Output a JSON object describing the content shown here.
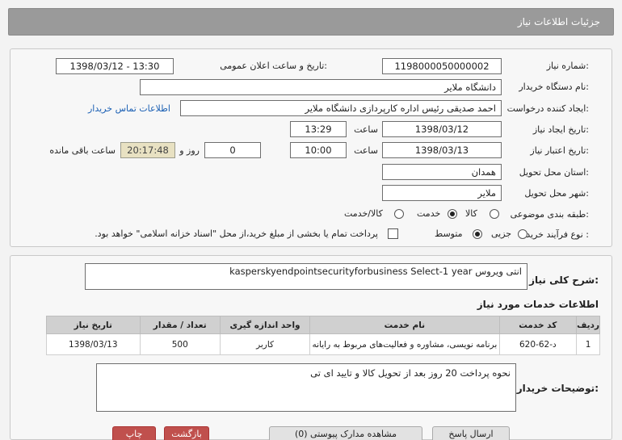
{
  "header": {
    "title": "جزئیات اطلاعات نیاز"
  },
  "form": {
    "need_number_label": "شماره نیاز:",
    "need_number": "1198000050000002",
    "announce_label": "تاریخ و ساعت اعلان عمومی:",
    "announce_value": "1398/03/12 - 13:30",
    "buyer_org_label": "نام دستگاه خریدار:",
    "buyer_org": "دانشگاه ملایر",
    "requester_label": "ایجاد کننده درخواست:",
    "requester": "احمد صدیقی رئیس اداره کارپردازی دانشگاه ملایر",
    "contact_link": "اطلاعات تماس خریدار",
    "created_date_label": "تاریخ ایجاد نیاز:",
    "created_date": "1398/03/12",
    "time_label": "ساعت",
    "created_time": "13:29",
    "validity_label": "تاریخ اعتبار نیاز:",
    "validity_date": "1398/03/13",
    "validity_time": "10:00",
    "days_value": "0",
    "days_label": "روز و",
    "remaining_time": "20:17:48",
    "remaining_label": "ساعت باقی مانده",
    "province_label": "استان محل تحویل:",
    "province": "همدان",
    "city_label": "شهر محل تحویل:",
    "city": "ملایر",
    "category_label": "طبقه بندی موضوعی:",
    "category_options": [
      "کالا",
      "خدمت",
      "کالا/خدمت"
    ],
    "process_label": "نوع فرآیند خرید :",
    "process_options": [
      "جزیی",
      "متوسط"
    ],
    "payment_note": "پرداخت تمام یا بخشی از مبلغ خرید،از محل \"اسناد خزانه اسلامی\" خواهد بود."
  },
  "summary": {
    "label": "شرح کلی نیاز:",
    "value": "انتی ویروس kasperskyendpointsecurityforbusiness Select-1 year"
  },
  "services": {
    "title": "اطلاعات خدمات مورد نیاز",
    "columns": [
      "ردیف",
      "کد خدمت",
      "نام خدمت",
      "واحد اندازه گیری",
      "تعداد / مقدار",
      "تاریخ نیاز"
    ],
    "rows": [
      [
        "1",
        "د-62-620",
        "برنامه نویسی، مشاوره و فعالیت‌های مربوط به رایانه",
        "کاربر",
        "500",
        "1398/03/13"
      ]
    ]
  },
  "description": {
    "label": "توضیحات خریدار:",
    "value": "نحوه پرداخت 20 روز بعد از تحویل کالا و تایید ای تی"
  },
  "footer": {
    "btn_print": "چاپ",
    "btn_back": "بازگشت",
    "btn_docs": "مشاهده مدارک پیوستی (0)",
    "btn_reply": "ارسال پاسخ"
  }
}
